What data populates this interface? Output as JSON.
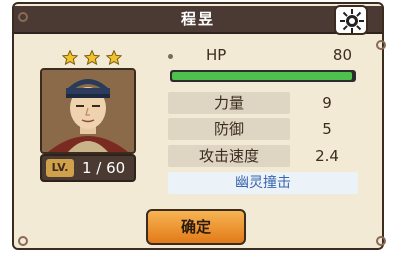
{
  "character": {
    "name": "程昱",
    "stars": 3,
    "level_tag": "LV.",
    "level_text": "1 / 60"
  },
  "stats": {
    "hp": {
      "label": "HP",
      "value": "80",
      "fraction": 0.99
    },
    "rows": [
      {
        "label": "力量",
        "value": "9"
      },
      {
        "label": "防御",
        "value": "5"
      },
      {
        "label": "攻击速度",
        "value": "2.4"
      }
    ]
  },
  "skill": {
    "name": "幽灵撞击"
  },
  "buttons": {
    "confirm_label": "确定"
  },
  "icons": {
    "settings": "settings-gear-icon",
    "star": "star-icon"
  },
  "colors": {
    "title_bar": "#4b3a34",
    "panel_bg": "#f3ead6",
    "hp_fill": "#4ec04e",
    "skill_text": "#3a66b0",
    "button": "#f0a040"
  }
}
